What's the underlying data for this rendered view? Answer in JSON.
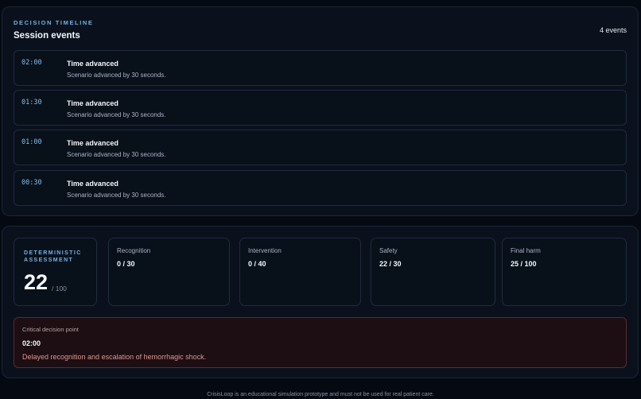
{
  "timeline": {
    "eyebrow": "DECISION TIMELINE",
    "title": "Session events",
    "count": "4 events",
    "events": [
      {
        "time": "02:00",
        "title": "Time advanced",
        "description": "Scenario advanced by 30 seconds."
      },
      {
        "time": "01:30",
        "title": "Time advanced",
        "description": "Scenario advanced by 30 seconds."
      },
      {
        "time": "01:00",
        "title": "Time advanced",
        "description": "Scenario advanced by 30 seconds."
      },
      {
        "time": "00:30",
        "title": "Time advanced",
        "description": "Scenario advanced by 30 seconds."
      }
    ]
  },
  "assessment": {
    "label": "DETERMINISTIC ASSESSMENT",
    "score": "22",
    "max": "/ 100",
    "metrics": [
      {
        "title": "Recognition",
        "value": "0 / 30"
      },
      {
        "title": "Intervention",
        "value": "0 / 40"
      },
      {
        "title": "Safety",
        "value": "22 / 30"
      },
      {
        "title": "Final harm",
        "value": "25 / 100"
      }
    ],
    "critical": {
      "label": "Critical decision point",
      "time": "02:00",
      "description": "Delayed recognition and escalation of hemorrhagic shock."
    }
  },
  "footer": "CrisisLoop is an educational simulation prototype and must not be used for real patient care."
}
